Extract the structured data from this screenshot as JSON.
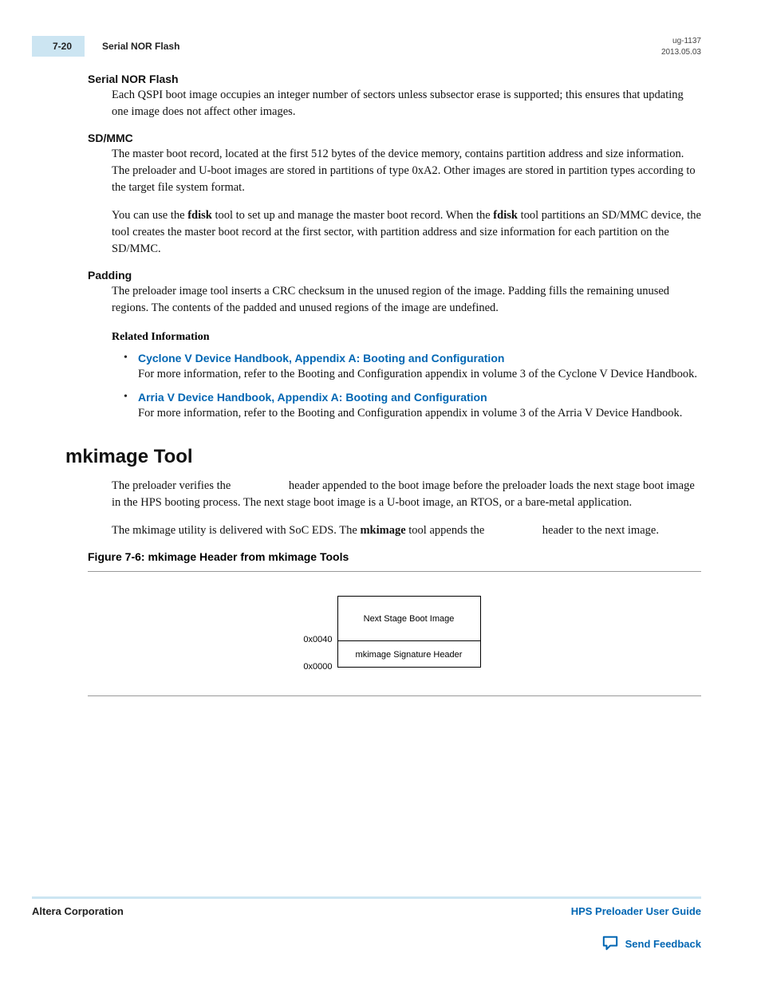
{
  "header": {
    "page_number": "7-20",
    "section_title": "Serial NOR Flash",
    "doc_id": "ug-1137",
    "date": "2013.05.03"
  },
  "sections": {
    "nor": {
      "title": "Serial NOR Flash",
      "p1": "Each QSPI boot image occupies an integer number of sectors unless subsector erase is supported; this ensures that updating one image does not affect other images."
    },
    "sdmmc": {
      "title": "SD/MMC",
      "p1": "The master boot record, located at the first 512 bytes of the device memory, contains partition address and size information. The preloader and U-boot images are stored in partitions of type 0xA2. Other images are stored in partition types according to the target file system format.",
      "p2a": "You can use the ",
      "p2b": "fdisk",
      "p2c": " tool to set up and manage the master boot record. When the ",
      "p2d": "fdisk",
      "p2e": " tool partitions an SD/MMC device, the tool creates the master boot record at the first sector, with partition address and size information for each partition on the SD/MMC."
    },
    "padding": {
      "title": "Padding",
      "p1": "The preloader image tool inserts a CRC checksum in the unused region of the image. Padding fills the remaining unused regions. The contents of the padded and unused regions of the image are undefined."
    },
    "related": {
      "title": "Related Information",
      "items": [
        {
          "link": "Cyclone V Device Handbook, Appendix A: Booting and Configuration",
          "desc": "For more information, refer to the Booting and Configuration appendix in volume 3 of the Cyclone V Device Handbook."
        },
        {
          "link": "Arria V Device Handbook, Appendix A: Booting and Configuration",
          "desc": "For more information, refer to the Booting and Configuration appendix in volume 3 of the Arria V Device Handbook."
        }
      ]
    },
    "mkimage": {
      "title": "mkimage Tool",
      "p1": "The preloader verifies the                    header appended to the boot image before the preloader loads the next stage boot image in the HPS booting process. The next stage boot image is a U-boot image, an RTOS, or a bare-metal application.",
      "p2a": "The mkimage utility is delivered with SoC EDS. The ",
      "p2b": "mkimage",
      "p2c": " tool appends the                    header to the next image.",
      "fig_title": "Figure 7-6: mkimage Header from mkimage Tools",
      "fig": {
        "row1": "Next Stage Boot Image",
        "row2": "mkimage Signature Header",
        "addr1": "0x0040",
        "addr2": "0x0000"
      }
    }
  },
  "footer": {
    "left": "Altera Corporation",
    "right": "HPS Preloader User Guide",
    "feedback": "Send Feedback"
  }
}
